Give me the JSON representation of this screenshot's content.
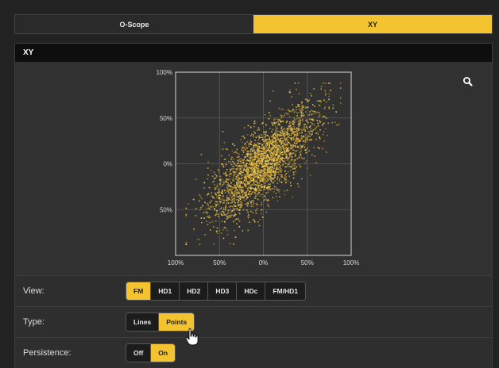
{
  "tabs": [
    {
      "label": "O-Scope",
      "active": false
    },
    {
      "label": "XY",
      "active": true
    }
  ],
  "panel": {
    "title": "XY"
  },
  "icons": {
    "search": "search-icon",
    "cursor": "hand-pointer-icon"
  },
  "colors": {
    "accent": "#f4c430",
    "background": "#313131",
    "header": "#0e0e0e",
    "points": "#e8b93a"
  },
  "chart_data": {
    "type": "scatter",
    "title": "",
    "xlabel": "",
    "ylabel": "",
    "x_ticks": [
      "100%",
      "50%",
      "0%",
      "50%",
      "100%"
    ],
    "y_ticks": [
      "100%",
      "50%",
      "0%",
      "50%"
    ],
    "xlim": [
      -100,
      100
    ],
    "ylim": [
      -100,
      100
    ],
    "grid": true,
    "correlation": 0.75,
    "point_count": 2600
  },
  "controls": {
    "view": {
      "label": "View:",
      "options": [
        "FM",
        "HD1",
        "HD2",
        "HD3",
        "HDc",
        "FM/HD1"
      ],
      "selected": "FM"
    },
    "type": {
      "label": "Type:",
      "options": [
        "Lines",
        "Points"
      ],
      "selected": "Points"
    },
    "persistence": {
      "label": "Persistence:",
      "options": [
        "Off",
        "On"
      ],
      "selected": "On"
    }
  }
}
